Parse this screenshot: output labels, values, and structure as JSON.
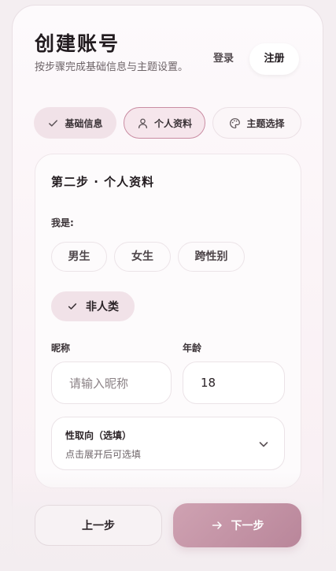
{
  "header": {
    "title": "创建账号",
    "subtitle": "按步骤完成基础信息与主题设置。"
  },
  "auth_tabs": {
    "login": "登录",
    "register": "注册",
    "active": "register"
  },
  "steps": [
    {
      "label": "基础信息",
      "icon": "check-icon",
      "status": "done"
    },
    {
      "label": "个人资料",
      "icon": "person-icon",
      "status": "active"
    },
    {
      "label": "主题选择",
      "icon": "palette-icon",
      "status": "pending"
    }
  ],
  "panel": {
    "title": "第二步 · 个人资料",
    "identity": {
      "label": "我是:",
      "options": [
        "男生",
        "女生",
        "跨性别",
        "非人类"
      ],
      "selected": "非人类"
    },
    "nickname": {
      "label": "昵称",
      "placeholder": "请输入昵称",
      "value": ""
    },
    "age": {
      "label": "年龄",
      "value": "18"
    },
    "orientation": {
      "title": "性取向（选填）",
      "hint": "点击展开后可选填"
    }
  },
  "footer": {
    "prev_label": "上一步",
    "next_label": "下一步"
  },
  "colors": {
    "accent": "#c98ca2",
    "primary_button": "#c498aa",
    "selected_chip": "#f1e2e8"
  }
}
